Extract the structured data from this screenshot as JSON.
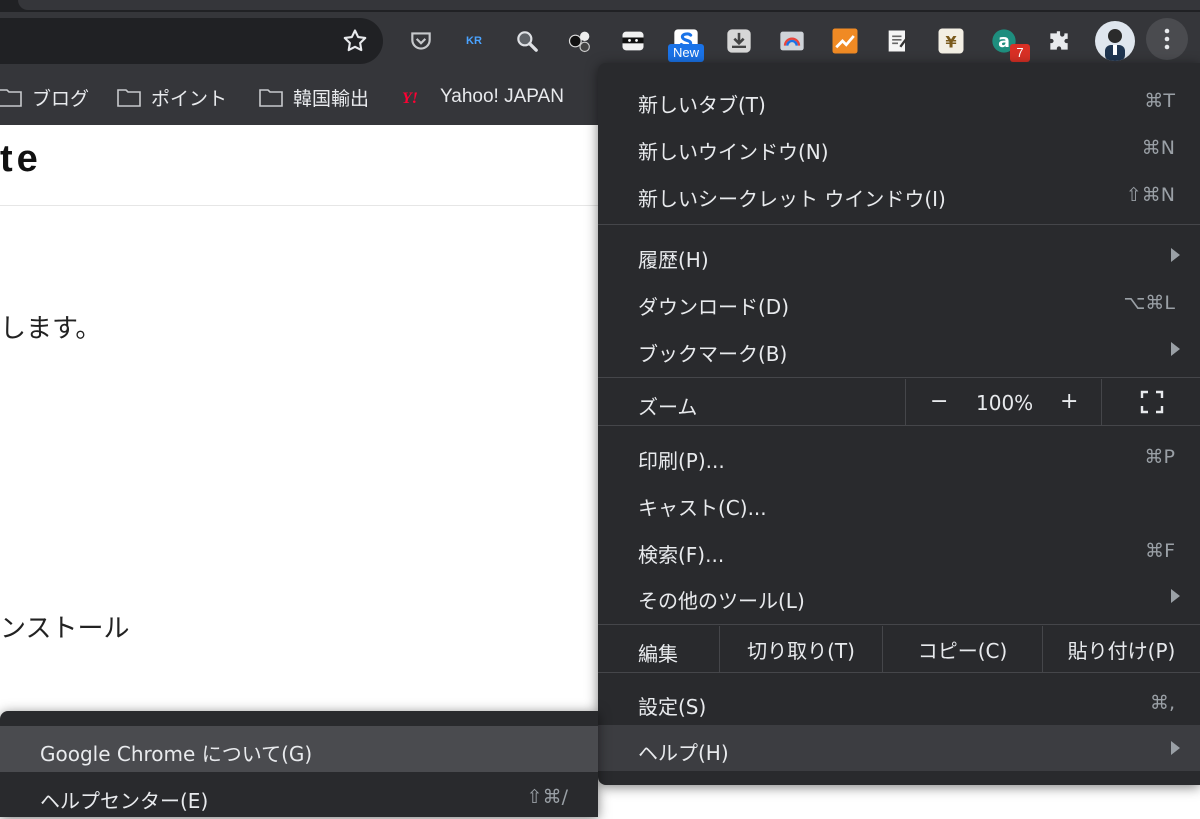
{
  "toolbar": {
    "extensions": [
      {
        "name": "pocket-icon"
      },
      {
        "name": "kr-icon",
        "text": "KR"
      },
      {
        "name": "magnifier-icon"
      },
      {
        "name": "balls-icon"
      },
      {
        "name": "ninja-icon"
      },
      {
        "name": "s-extension-icon"
      },
      {
        "name": "download-icon"
      },
      {
        "name": "print-ext-icon"
      },
      {
        "name": "chart-ext-icon"
      },
      {
        "name": "note-ext-icon"
      },
      {
        "name": "yen-ext-icon"
      },
      {
        "name": "a-ext-icon"
      },
      {
        "name": "puzzle-icon"
      },
      {
        "name": "avatar"
      }
    ],
    "new_badge": "New",
    "count_badge": "7"
  },
  "bookmarks": [
    {
      "label": "ブログ",
      "icon": "folder-icon"
    },
    {
      "label": "ポイント",
      "icon": "folder-icon"
    },
    {
      "label": "韓国輸出",
      "icon": "folder-icon"
    },
    {
      "label": "Yahoo! JAPAN",
      "icon": "yahoo-icon"
    }
  ],
  "page": {
    "title_fragment": "te",
    "text1": "します。",
    "text2": "ンストール"
  },
  "menu": {
    "new_tab": {
      "label": "新しいタブ(T)",
      "shortcut": "⌘T"
    },
    "new_window": {
      "label": "新しいウインドウ(N)",
      "shortcut": "⌘N"
    },
    "new_incognito": {
      "label": "新しいシークレット ウインドウ(I)",
      "shortcut": "⇧⌘N"
    },
    "history": {
      "label": "履歴(H)"
    },
    "downloads": {
      "label": "ダウンロード(D)",
      "shortcut": "⌥⌘L"
    },
    "bookmarks": {
      "label": "ブックマーク(B)"
    },
    "zoom": {
      "label": "ズーム",
      "minus": "−",
      "value": "100%",
      "plus": "+"
    },
    "print": {
      "label": "印刷(P)...",
      "shortcut": "⌘P"
    },
    "cast": {
      "label": "キャスト(C)..."
    },
    "find": {
      "label": "検索(F)...",
      "shortcut": "⌘F"
    },
    "more_tools": {
      "label": "その他のツール(L)"
    },
    "edit": {
      "label": "編集",
      "cut": "切り取り(T)",
      "copy": "コピー(C)",
      "paste": "貼り付け(P)"
    },
    "settings": {
      "label": "設定(S)",
      "shortcut": "⌘,"
    },
    "help": {
      "label": "ヘルプ(H)"
    }
  },
  "submenu": {
    "about": {
      "label": "Google Chrome について(G)"
    },
    "help_center": {
      "label": "ヘルプセンター(E)",
      "shortcut": "⇧⌘/"
    }
  }
}
